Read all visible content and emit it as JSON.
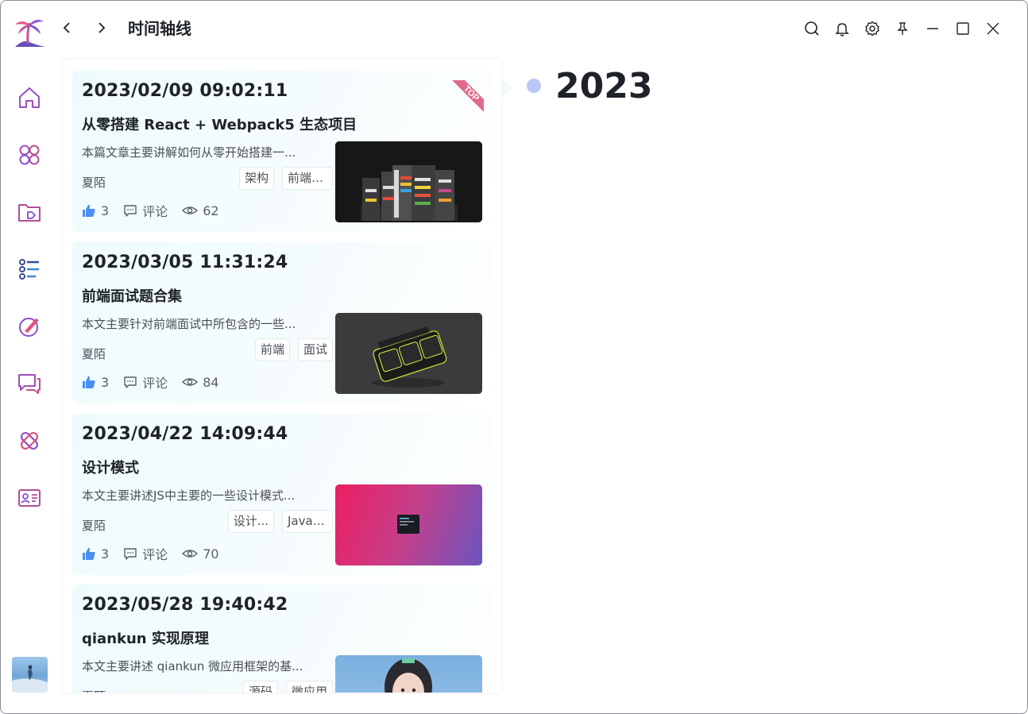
{
  "header": {
    "title": "时间轴线"
  },
  "timeline": {
    "year": "2023"
  },
  "ribbon": {
    "label": "TOP"
  },
  "cards": [
    {
      "date": "2023/02/09 09:02:11",
      "title": "从零搭建 React + Webpack5 生态项目",
      "desc": "本篇文章主要讲解如何从零开始搭建一...",
      "author": "夏陌",
      "tags": [
        "架构",
        "前端框架"
      ],
      "likes": "3",
      "comment_label": "评论",
      "views": "62",
      "pinned": true
    },
    {
      "date": "2023/03/05 11:31:24",
      "title": "前端面试题合集",
      "desc": "本文主要针对前端面试中所包含的一些...",
      "author": "夏陌",
      "tags": [
        "前端",
        "面试"
      ],
      "likes": "3",
      "comment_label": "评论",
      "views": "84",
      "pinned": false
    },
    {
      "date": "2023/04/22 14:09:44",
      "title": "设计模式",
      "desc": "本文主要讲述JS中主要的一些设计模式...",
      "author": "夏陌",
      "tags": [
        "设计...",
        "JavaS..."
      ],
      "likes": "3",
      "comment_label": "评论",
      "views": "70",
      "pinned": false
    },
    {
      "date": "2023/05/28 19:40:42",
      "title": "qiankun 实现原理",
      "desc": "本文主要讲述 qiankun 微应用框架的基...",
      "author": "夏陌",
      "tags": [
        "源码",
        "微应用"
      ],
      "likes": "",
      "comment_label": "",
      "views": "",
      "pinned": false
    }
  ],
  "colors": {
    "accent_purple": "#8a5bd6",
    "accent_pink": "#e0527a",
    "like_blue": "#4a8ef0",
    "dot": "#b9c8f5",
    "ribbon": "#e06a8a"
  }
}
